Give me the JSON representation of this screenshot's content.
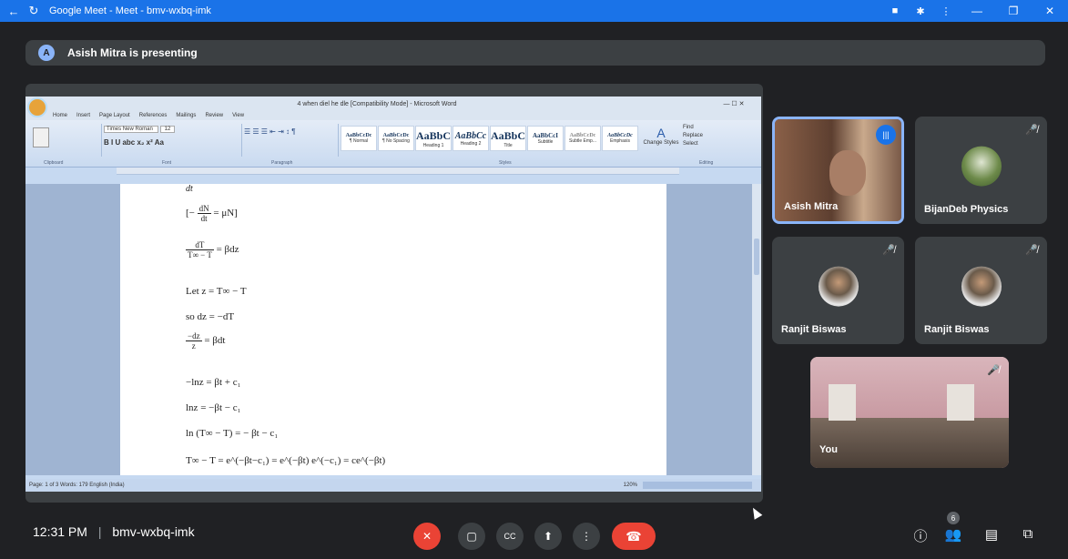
{
  "browser": {
    "title": "Google Meet - Meet - bmv-wxbq-imk",
    "back_glyph": "←",
    "reload_glyph": "↻",
    "icons": [
      "camera-icon",
      "extensions-icon",
      "menu-icon"
    ],
    "minimize": "—",
    "restore": "❐",
    "close": "✕"
  },
  "presenting": {
    "avatar_letter": "A",
    "text": "Asish Mitra is presenting"
  },
  "word": {
    "window_title": "4 when diel he dle [Compatibility Mode] - Microsoft Word",
    "tabs": [
      "Home",
      "Insert",
      "Page Layout",
      "References",
      "Mailings",
      "Review",
      "View"
    ],
    "font_name": "Times New Roman",
    "font_size": "12",
    "styles": [
      {
        "sample": "AaBbCcDc",
        "label": "¶ Normal"
      },
      {
        "sample": "AaBbCcDc",
        "label": "¶ No Spacing"
      },
      {
        "sample": "AaBbC",
        "label": "Heading 1"
      },
      {
        "sample": "AaBbCc",
        "label": "Heading 2"
      },
      {
        "sample": "AaBbC",
        "label": "Title"
      },
      {
        "sample": "AaBbCcI",
        "label": "Subtitle"
      },
      {
        "sample": "AaBbCcDc",
        "label": "Subtle Emp..."
      },
      {
        "sample": "AaBbCcDc",
        "label": "Emphasis"
      }
    ],
    "group_labels": {
      "clipboard": "Clipboard",
      "font": "Font",
      "paragraph": "Paragraph",
      "styles": "Styles",
      "editing": "Editing"
    },
    "editing": [
      "Find",
      "Replace",
      "Select"
    ],
    "change_styles": "Change Styles",
    "status": "Page: 1 of 3    Words: 179    English (India)",
    "zoom": "120%"
  },
  "doc": {
    "line0": "dt",
    "eq1_pre": "[−",
    "eq1_num": "dN",
    "eq1_den": "dt",
    "eq1_post": "= μN]",
    "eq2_num": "dT",
    "eq2_den": "T∞ − T",
    "eq2_post": "= βdz",
    "eq3": "Let z = T∞ − T",
    "eq4": "so dz = −dT",
    "eq5_num": "−dz",
    "eq5_den": "z",
    "eq5_post": "= βdt",
    "eq6": "−lnz = βt + c₁",
    "eq7": "lnz = −βt − c₁",
    "eq8": "ln (T∞ − T) = − βt − c₁",
    "eq9": "T∞ − T = e^(−βt−c₁) = e^(−βt) e^(−c₁) = ce^(−βt)"
  },
  "participants": [
    {
      "name": "Asish Mitra",
      "speaking": true
    },
    {
      "name": "BijanDeb Physics",
      "muted": true
    },
    {
      "name": "Ranjit Biswas",
      "muted": true
    },
    {
      "name": "Ranjit Biswas",
      "muted": true
    },
    {
      "name": "You",
      "muted": true
    }
  ],
  "footer": {
    "time": "12:31 PM",
    "separator": "|",
    "meeting_code": "bmv-wxbq-imk",
    "people_count": "6"
  },
  "colors": {
    "accent": "#1a73e8",
    "danger": "#ea4335",
    "bg": "#202124",
    "tile": "#3c4043"
  }
}
